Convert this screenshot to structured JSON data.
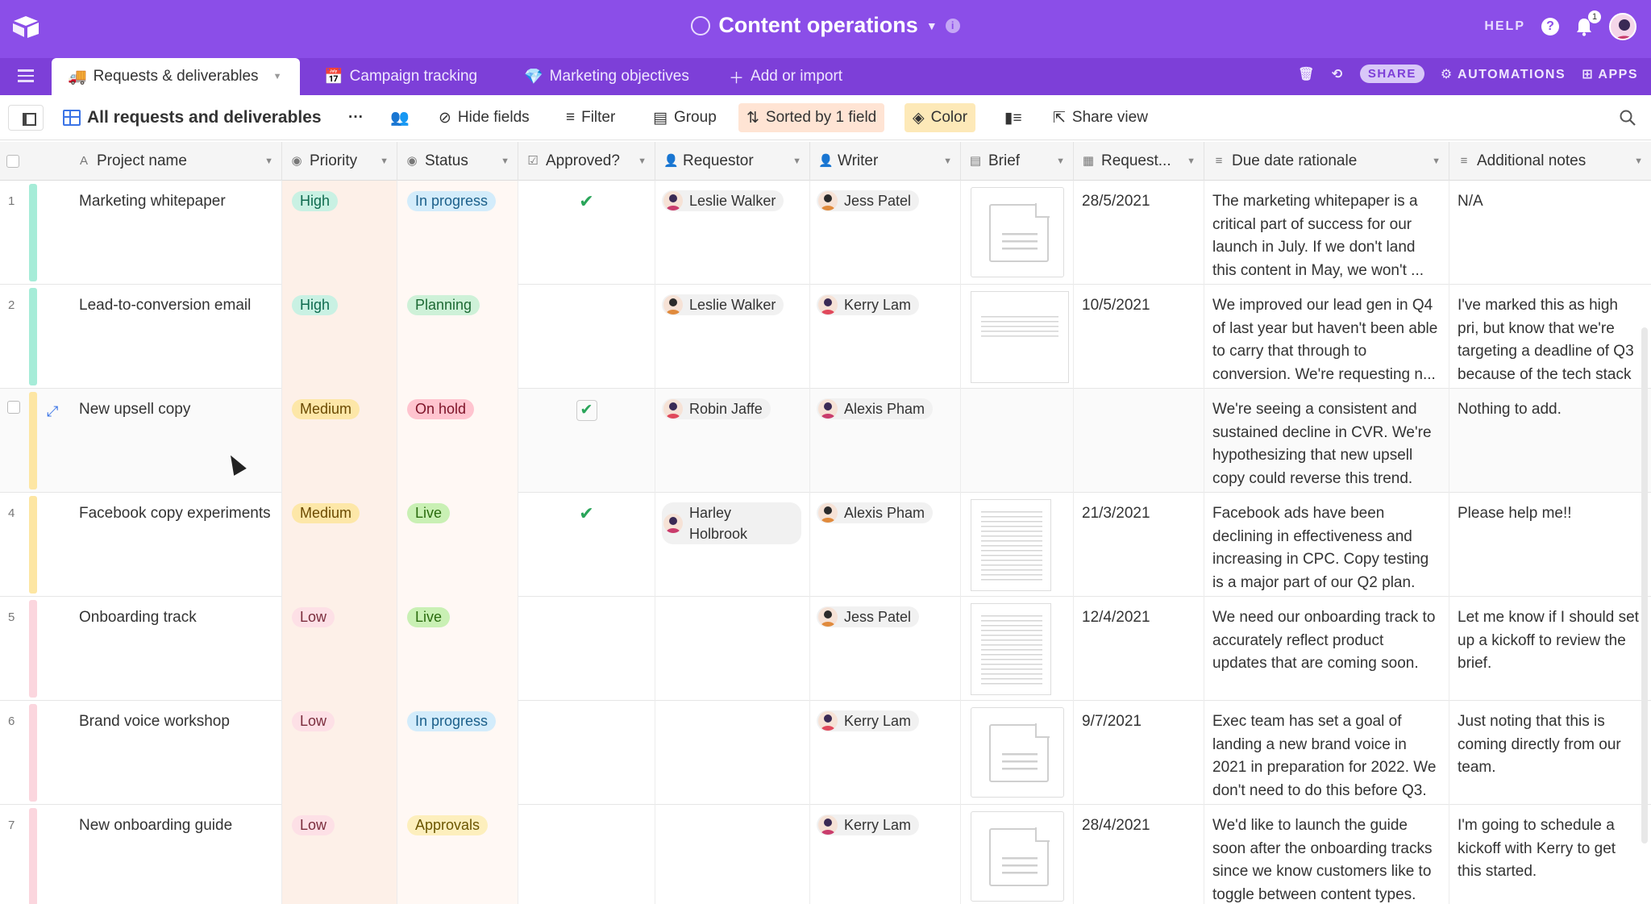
{
  "app": {
    "base_title": "Content operations",
    "help_label": "HELP",
    "help_glyph": "?",
    "notification_count": "1",
    "info_glyph": "i"
  },
  "tabs": [
    {
      "label": "Requests & deliverables",
      "emoji": "🚚",
      "active": true
    },
    {
      "label": "Campaign tracking",
      "emoji": "📅"
    },
    {
      "label": "Marketing objectives",
      "emoji": "💎"
    },
    {
      "label": "Add or import",
      "emoji": "＋"
    }
  ],
  "tab_actions": {
    "share": "SHARE",
    "automations": "AUTOMATIONS",
    "apps": "APPS"
  },
  "view": {
    "name": "All requests and deliverables",
    "more": "···",
    "hide_fields": "Hide fields",
    "filter": "Filter",
    "group": "Group",
    "sort": "Sorted by 1 field",
    "color": "Color",
    "share_view": "Share view"
  },
  "columns": [
    {
      "label": "Project name",
      "type_glyph": "A"
    },
    {
      "label": "Priority",
      "type_glyph": "◉"
    },
    {
      "label": "Status",
      "type_glyph": "◉"
    },
    {
      "label": "Approved?",
      "type_glyph": "☑"
    },
    {
      "label": "Requestor",
      "type_glyph": "👤"
    },
    {
      "label": "Writer",
      "type_glyph": "👤"
    },
    {
      "label": "Brief",
      "type_glyph": "▤"
    },
    {
      "label": "Request...",
      "type_glyph": "▦"
    },
    {
      "label": "Due date rationale",
      "type_glyph": "≡"
    },
    {
      "label": "Additional notes",
      "type_glyph": "≡"
    }
  ],
  "rows": [
    {
      "num": "1",
      "name": "Marketing whitepaper",
      "priority": "High",
      "status": "In progress",
      "approved": "✔",
      "requestor": "Leslie Walker",
      "writer": "Jess Patel",
      "brief": "doc",
      "date": "28/5/2021",
      "rationale": "The marketing whitepaper is a critical part of success for our launch in July. If we don't land this content in May, we won't ...",
      "notes": "N/A"
    },
    {
      "num": "2",
      "name": "Lead-to-conversion email",
      "priority": "High",
      "status": "Planning",
      "approved": "",
      "requestor": "Leslie Walker",
      "writer": "Kerry Lam",
      "brief": "wide",
      "date": "10/5/2021",
      "rationale": "We improved our lead gen in Q4 of last year but haven't been able to carry that through to conversion. We're requesting n...",
      "notes": "I've marked this as high pri, but know that we're targeting a deadline of Q3 because of the tech stack ..."
    },
    {
      "num": "",
      "name": "New upsell copy",
      "priority": "Medium",
      "status": "On hold",
      "approved": "✔",
      "requestor": "Robin Jaffe",
      "writer": "Alexis Pham",
      "brief": "",
      "date": "",
      "rationale": "We're seeing a consistent and sustained decline in CVR. We're hypothesizing that new upsell copy could reverse this trend.",
      "notes": "Nothing to add."
    },
    {
      "num": "4",
      "name": "Facebook copy experiments",
      "priority": "Medium",
      "status": "Live",
      "approved": "✔",
      "requestor": "Harley Holbrook",
      "writer": "Alexis Pham",
      "brief": "thumb",
      "date": "21/3/2021",
      "rationale": "Facebook ads have been declining in effectiveness and increasing in CPC. Copy testing is a major part of our Q2 plan.",
      "notes": "Please help me!!"
    },
    {
      "num": "5",
      "name": "Onboarding track",
      "priority": "Low",
      "status": "Live",
      "approved": "",
      "requestor": "",
      "writer": "Jess Patel",
      "brief": "thumb",
      "date": "12/4/2021",
      "rationale": "We need our onboarding track to accurately reflect product updates that are coming soon.",
      "notes": "Let me know if I should set up a kickoff to review the brief."
    },
    {
      "num": "6",
      "name": "Brand voice workshop",
      "priority": "Low",
      "status": "In progress",
      "approved": "",
      "requestor": "",
      "writer": "Kerry Lam",
      "brief": "doc",
      "date": "9/7/2021",
      "rationale": "Exec team has set a goal of landing a new brand voice in 2021 in preparation for 2022. We don't need to do this before Q3.",
      "notes": "Just noting that this is coming directly from our team."
    },
    {
      "num": "7",
      "name": "New onboarding guide",
      "priority": "Low",
      "status": "Approvals",
      "approved": "",
      "requestor": "",
      "writer": "Kerry Lam",
      "brief": "doc",
      "date": "28/4/2021",
      "rationale": "We'd like to launch the guide soon after the onboarding tracks since we know customers like to toggle between content types.",
      "notes": "I'm going to schedule a kickoff with Kerry to get this started."
    }
  ],
  "colors": {
    "topbar": "#8b4ee8",
    "tabbar": "#7d3fd8",
    "high_bar": "#a6ecd8",
    "medium_bar": "#fde6a3",
    "low_bar": "#fbd6de"
  }
}
